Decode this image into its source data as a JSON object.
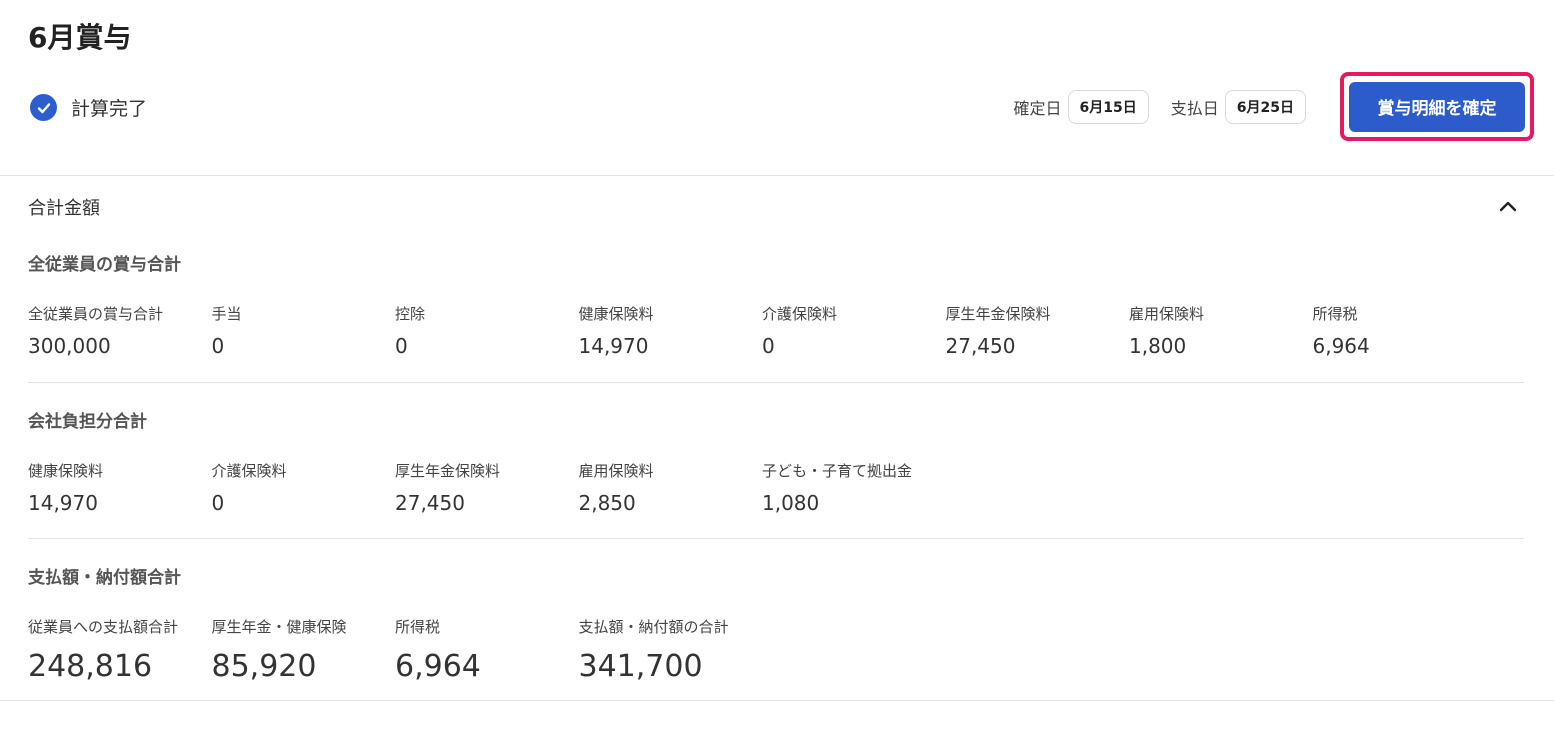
{
  "page": {
    "title": "6月賞与"
  },
  "status": {
    "label": "計算完了"
  },
  "dates": {
    "confirm_label": "確定日",
    "confirm_value": "6月15日",
    "pay_label": "支払日",
    "pay_value": "6月25日"
  },
  "actions": {
    "confirm_button": "賞与明細を確定"
  },
  "totals": {
    "header": "合計金額",
    "employees": {
      "title": "全従業員の賞与合計",
      "items": [
        {
          "label": "全従業員の賞与合計",
          "value": "300,000"
        },
        {
          "label": "手当",
          "value": "0"
        },
        {
          "label": "控除",
          "value": "0"
        },
        {
          "label": "健康保険料",
          "value": "14,970"
        },
        {
          "label": "介護保険料",
          "value": "0"
        },
        {
          "label": "厚生年金保険料",
          "value": "27,450"
        },
        {
          "label": "雇用保険料",
          "value": "1,800"
        },
        {
          "label": "所得税",
          "value": "6,964"
        }
      ]
    },
    "company": {
      "title": "会社負担分合計",
      "items": [
        {
          "label": "健康保険料",
          "value": "14,970"
        },
        {
          "label": "介護保険料",
          "value": "0"
        },
        {
          "label": "厚生年金保険料",
          "value": "27,450"
        },
        {
          "label": "雇用保険料",
          "value": "2,850"
        },
        {
          "label": "子ども・子育て拠出金",
          "value": "1,080"
        }
      ]
    },
    "payments": {
      "title": "支払額・納付額合計",
      "items": [
        {
          "label": "従業員への支払額合計",
          "value": "248,816"
        },
        {
          "label": "厚生年金・健康保険",
          "value": "85,920"
        },
        {
          "label": "所得税",
          "value": "6,964"
        },
        {
          "label": "支払額・納付額の合計",
          "value": "341,700"
        }
      ]
    }
  },
  "colors": {
    "accent": "#2c5ccb",
    "highlight_border": "#e5195e",
    "check": "#2b5fd0"
  }
}
